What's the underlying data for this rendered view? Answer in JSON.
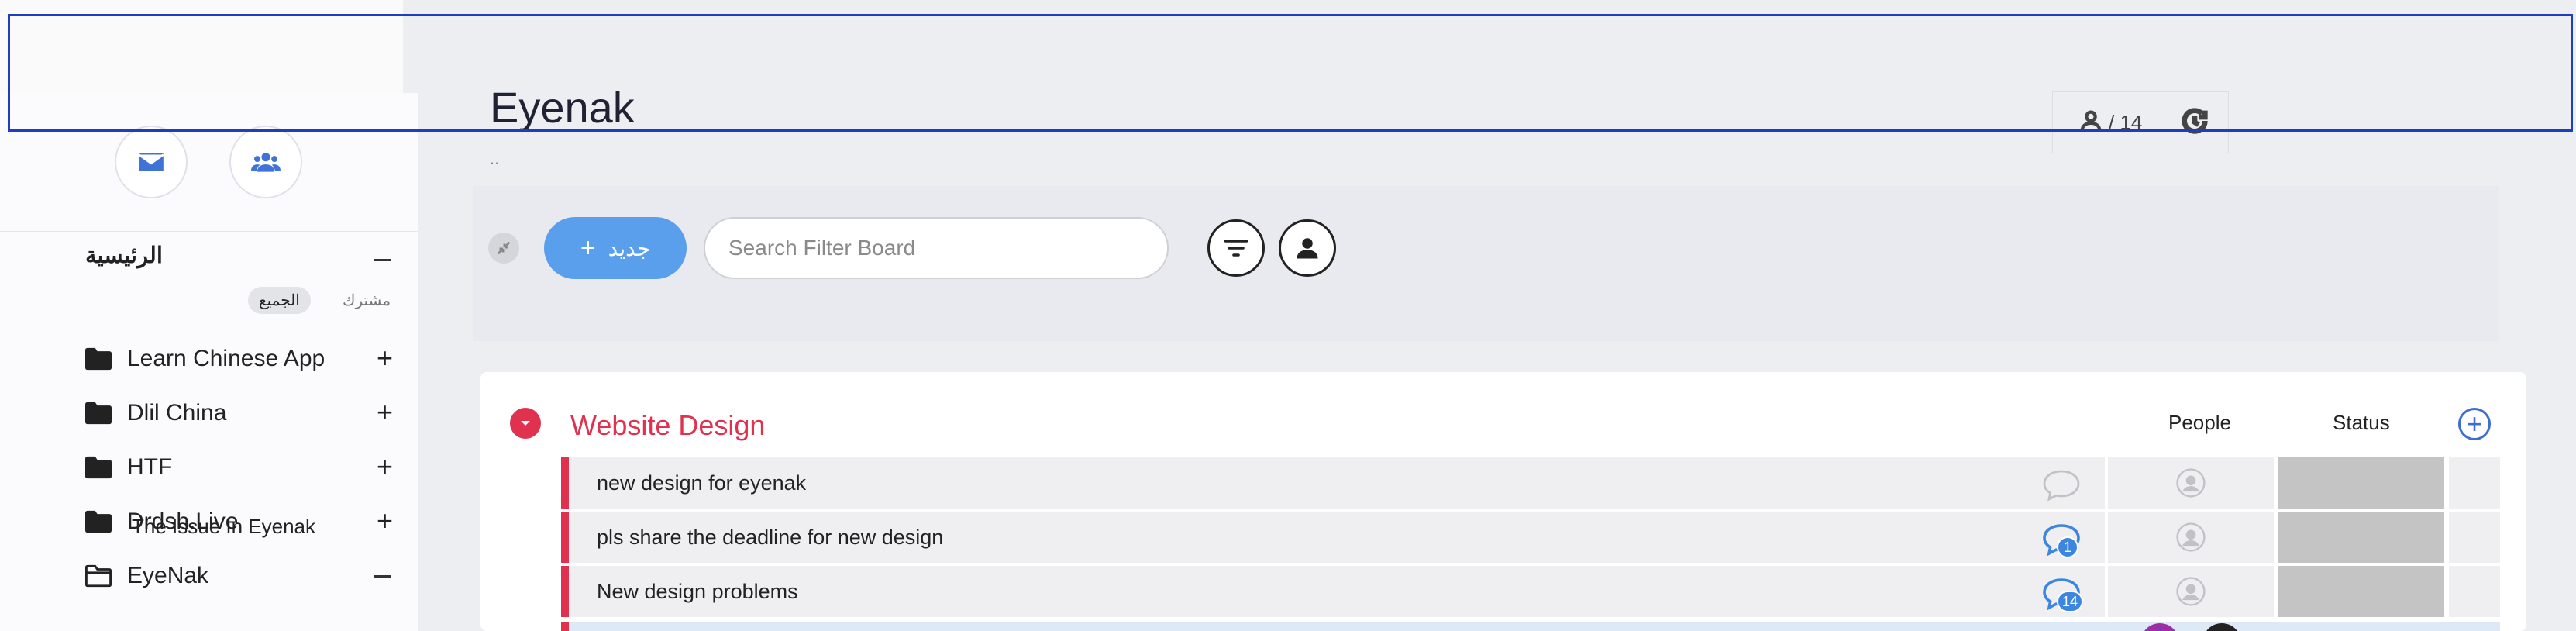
{
  "sidebar": {
    "home_title": "الرئيسية",
    "filters": [
      {
        "label": "مشترك",
        "active": false
      },
      {
        "label": "الجميع",
        "active": true
      }
    ],
    "projects": [
      {
        "label": "Learn Chinese App",
        "expanded": false
      },
      {
        "label": "Dlil China",
        "expanded": false
      },
      {
        "label": "HTF",
        "expanded": false
      },
      {
        "label": "Drdsh.Live",
        "expanded": false
      },
      {
        "label": "EyeNak",
        "expanded": true
      }
    ],
    "sub_items": [
      "The Issue In Eyenak"
    ]
  },
  "header": {
    "title": "Eyenak",
    "subtitle": "..",
    "member_count": "/ 14"
  },
  "toolbar": {
    "new_label": "جديد",
    "search_placeholder": "Search Filter Board"
  },
  "group": {
    "title": "Website Design",
    "color": "#e0314f",
    "columns": [
      "People",
      "Status"
    ],
    "rows": [
      {
        "text": "new design for eyenak",
        "comments": null
      },
      {
        "text": "pls share the deadline for new design",
        "comments": "1"
      },
      {
        "text": "New design problems",
        "comments": "14"
      }
    ]
  },
  "colors": {
    "accent": "#5a9fec",
    "link_blue": "#3d6fd0",
    "group_red": "#e0314f"
  }
}
